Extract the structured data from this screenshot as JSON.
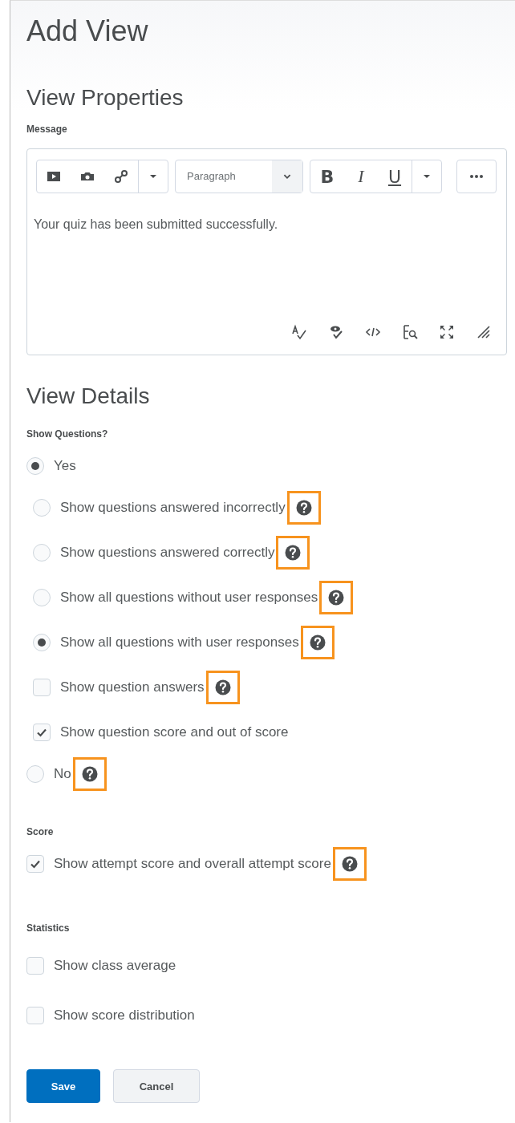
{
  "title": "Add View",
  "properties": {
    "heading": "View Properties",
    "message_label": "Message",
    "editor": {
      "format_buttons": [
        "B",
        "I",
        "U"
      ],
      "block_format": "Paragraph",
      "body": "Your quiz has been submitted successfully."
    }
  },
  "details": {
    "heading": "View Details",
    "groups": [
      {
        "label": "Show Questions?",
        "options": [
          {
            "kind": "radio",
            "label": "Yes",
            "selected": true,
            "children": [
              {
                "kind": "radio",
                "label": "Show questions answered incorrectly",
                "selected": false,
                "help": true,
                "highlighted": true
              },
              {
                "kind": "radio",
                "label": "Show questions answered correctly",
                "selected": false,
                "help": true,
                "highlighted": true
              },
              {
                "kind": "radio",
                "label": "Show all questions without user responses",
                "selected": false,
                "help": true,
                "highlighted": true
              },
              {
                "kind": "radio",
                "label": "Show all questions with user responses",
                "selected": true,
                "help": true,
                "highlighted": true
              },
              {
                "kind": "checkbox",
                "label": "Show question answers",
                "checked": false,
                "help": true,
                "highlighted": true
              },
              {
                "kind": "checkbox",
                "label": "Show question score and out of score",
                "checked": true
              }
            ]
          },
          {
            "kind": "radio",
            "label": "No",
            "selected": false,
            "help": true,
            "highlighted": true
          }
        ]
      },
      {
        "label": "Score",
        "options": [
          {
            "kind": "checkbox",
            "label": "Show attempt score and overall attempt score",
            "checked": true,
            "help": true,
            "highlighted": true
          }
        ]
      },
      {
        "label": "Statistics",
        "options": [
          {
            "kind": "checkbox",
            "label": "Show class average",
            "checked": false
          },
          {
            "kind": "checkbox",
            "label": "Show score distribution",
            "checked": false
          }
        ]
      }
    ]
  },
  "buttons": [
    {
      "label": "Save",
      "primary": true
    },
    {
      "label": "Cancel",
      "primary": false
    }
  ]
}
